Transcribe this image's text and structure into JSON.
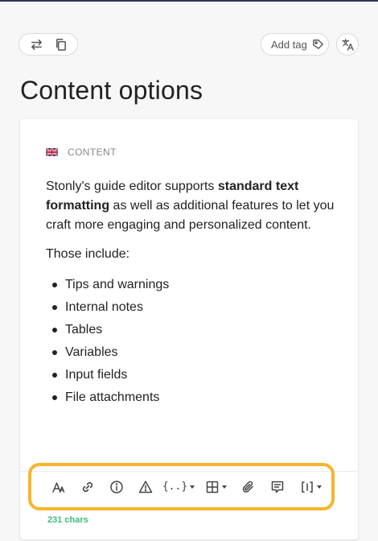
{
  "header": {
    "add_tag_label": "Add tag"
  },
  "page": {
    "title": "Content options"
  },
  "content": {
    "section_label": "CONTENT",
    "paragraph1_pre": "Stonly's guide editor supports ",
    "paragraph1_bold": "standard text formatting",
    "paragraph1_post": " as well as additional features to let you craft more engaging and personalized content.",
    "paragraph2": "Those include:",
    "list": [
      "Tips and warnings",
      "Internal notes",
      "Tables",
      "Variables",
      "Input fields",
      "File attachments"
    ]
  },
  "toolbar": {
    "variables_glyph": "{..}",
    "char_count": "231 chars"
  },
  "colors": {
    "highlight": "#f7b52b",
    "char_count": "#3bbf7a"
  }
}
